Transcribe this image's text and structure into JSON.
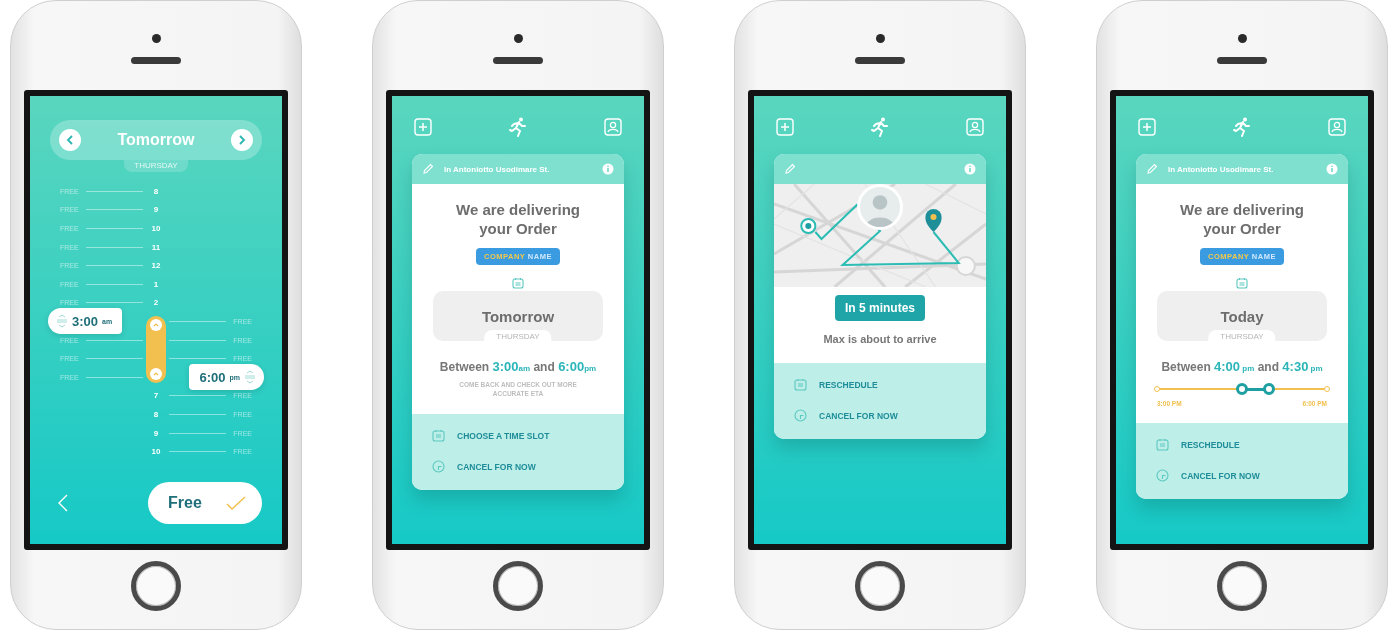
{
  "phones": [
    {
      "kind": "time_picker",
      "header": {
        "day": "Tomorrow",
        "weekday": "THURSDAY"
      },
      "rows": [
        {
          "hour": "8",
          "left": "FREE",
          "selected": false
        },
        {
          "hour": "9",
          "left": "FREE",
          "selected": false
        },
        {
          "hour": "10",
          "left": "FREE",
          "selected": false
        },
        {
          "hour": "11",
          "left": "FREE",
          "selected": false
        },
        {
          "hour": "12",
          "left": "FREE",
          "selected": false
        },
        {
          "hour": "1",
          "left": "FREE",
          "selected": false
        },
        {
          "hour": "2",
          "left": "FREE",
          "selected": false
        },
        {
          "right": "FREE",
          "selected": true
        },
        {
          "left": "FREE",
          "right": "FREE",
          "selected": true
        },
        {
          "left": "FREE",
          "right": "FREE",
          "selected": true
        },
        {
          "left": "FREE",
          "selected": true
        },
        {
          "hour": "7",
          "right": "FREE",
          "selected": false
        },
        {
          "hour": "8",
          "right": "FREE",
          "selected": false
        },
        {
          "hour": "9",
          "right": "FREE",
          "selected": false
        },
        {
          "hour": "10",
          "right": "FREE",
          "selected": false
        }
      ],
      "start": {
        "time": "3:00",
        "suffix": "am"
      },
      "end": {
        "time": "6:00",
        "suffix": "pm"
      },
      "confirm": {
        "label": "Free"
      }
    },
    {
      "kind": "delivery",
      "address": "In Antoniotto Usodimare St.",
      "title": "We are delivering your Order",
      "company": {
        "first": "COMPANY",
        "second": "NAME"
      },
      "day": "Tomorrow",
      "weekday": "THURSDAY",
      "window": [
        {
          "kind": "plain",
          "text": "Between "
        },
        {
          "kind": "time",
          "text": "3:00"
        },
        {
          "kind": "suffix",
          "text": "am"
        },
        {
          "kind": "plain",
          "text": " and "
        },
        {
          "kind": "time",
          "text": "6:00"
        },
        {
          "kind": "suffix",
          "text": "pm"
        }
      ],
      "note": "COME BACK AND CHECK OUT MORE ACCURATE ETA",
      "actions": [
        {
          "kind": "calendar",
          "label": "CHOOSE A TIME SLOT"
        },
        {
          "kind": "clock",
          "label": "CANCEL FOR NOW"
        }
      ]
    },
    {
      "kind": "tracking",
      "eta": "In 5 minutes",
      "message": "Max is about to arrive",
      "actions": [
        {
          "kind": "calendar",
          "label": "RESCHEDULE"
        },
        {
          "kind": "clock",
          "label": "CANCEL FOR NOW"
        }
      ]
    },
    {
      "kind": "delivery",
      "address": "In Antoniotto Usodimare St.",
      "title": "We are delivering your Order",
      "company": {
        "first": "COMPANY",
        "second": "NAME"
      },
      "day": "Today",
      "weekday": "THURSDAY",
      "window": [
        {
          "kind": "plain",
          "text": "Between "
        },
        {
          "kind": "time",
          "text": "4:00"
        },
        {
          "kind": "suffix",
          "text": " pm"
        },
        {
          "kind": "plain",
          "text": " and "
        },
        {
          "kind": "time",
          "text": "4:30"
        },
        {
          "kind": "suffix",
          "text": " pm"
        }
      ],
      "range": {
        "start_label": "3:00 PM",
        "end_label": "6:00 PM",
        "handles": [
          {
            "level": 0.5
          },
          {
            "level": 0.66
          }
        ]
      },
      "actions": [
        {
          "kind": "calendar",
          "label": "RESCHEDULE"
        },
        {
          "kind": "clock",
          "label": "CANCEL FOR NOW"
        }
      ]
    }
  ]
}
